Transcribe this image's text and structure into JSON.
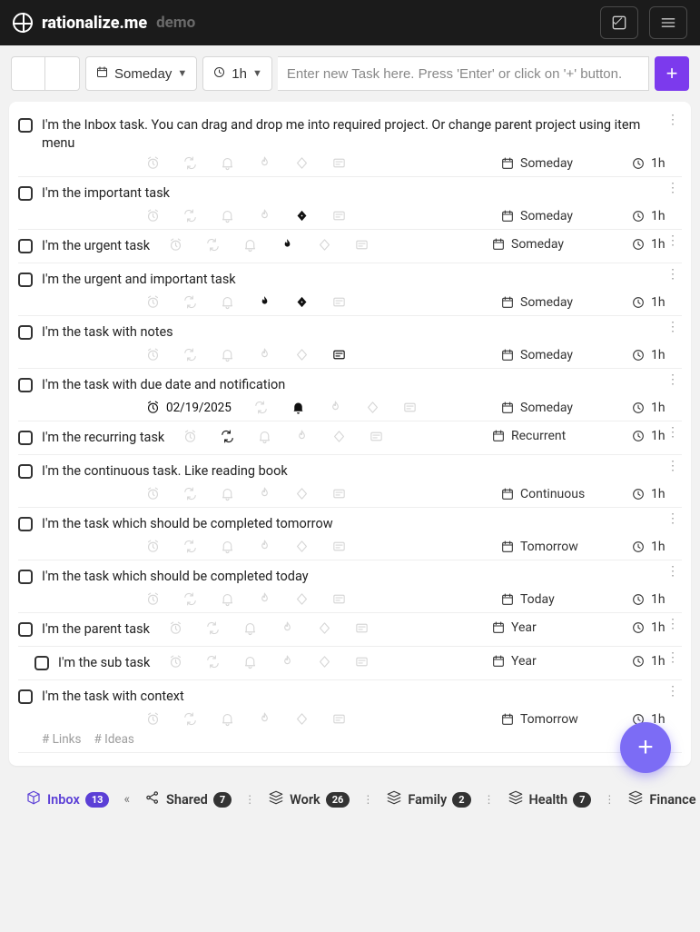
{
  "brand": {
    "name": "rationalize.me",
    "suffix": "demo"
  },
  "toolbar": {
    "schedule_label": "Someday",
    "duration_label": "1h",
    "input_placeholder": "Enter new Task here. Press 'Enter' or click on '+' button."
  },
  "tasks": [
    {
      "title": "I'm the Inbox task. You can drag and drop me into required project. Or change parent project using item menu",
      "schedule": "Someday",
      "duration": "1h",
      "flags": {
        "urgent": false,
        "important": false,
        "notes": false,
        "bell": false,
        "repeat": false,
        "due": false
      },
      "inline_meta": false,
      "sub": false
    },
    {
      "title": "I'm the important task",
      "schedule": "Someday",
      "duration": "1h",
      "flags": {
        "urgent": false,
        "important": true,
        "notes": false,
        "bell": false,
        "repeat": false,
        "due": false
      },
      "inline_meta": false,
      "sub": false
    },
    {
      "title": "I'm the urgent task",
      "schedule": "Someday",
      "duration": "1h",
      "flags": {
        "urgent": true,
        "important": false,
        "notes": false,
        "bell": false,
        "repeat": false,
        "due": false
      },
      "inline_meta": true,
      "sub": false
    },
    {
      "title": "I'm the urgent and important task",
      "schedule": "Someday",
      "duration": "1h",
      "flags": {
        "urgent": true,
        "important": true,
        "notes": false,
        "bell": false,
        "repeat": false,
        "due": false
      },
      "inline_meta": false,
      "sub": false
    },
    {
      "title": "I'm the task with notes",
      "schedule": "Someday",
      "duration": "1h",
      "flags": {
        "urgent": false,
        "important": false,
        "notes": true,
        "bell": false,
        "repeat": false,
        "due": false
      },
      "inline_meta": false,
      "sub": false
    },
    {
      "title": "I'm the task with due date and notification",
      "schedule": "Someday",
      "duration": "1h",
      "flags": {
        "urgent": false,
        "important": false,
        "notes": false,
        "bell": true,
        "repeat": false,
        "due": true
      },
      "due_date": "02/19/2025",
      "inline_meta": false,
      "sub": false
    },
    {
      "title": "I'm the recurring task",
      "schedule": "Recurrent",
      "duration": "1h",
      "flags": {
        "urgent": false,
        "important": false,
        "notes": false,
        "bell": false,
        "repeat": true,
        "due": false
      },
      "inline_meta": true,
      "sub": false
    },
    {
      "title": "I'm the continuous task. Like reading book",
      "schedule": "Continuous",
      "duration": "1h",
      "flags": {
        "urgent": false,
        "important": false,
        "notes": false,
        "bell": false,
        "repeat": false,
        "due": false
      },
      "inline_meta": false,
      "sub": false
    },
    {
      "title": "I'm the task which should be completed tomorrow",
      "schedule": "Tomorrow",
      "duration": "1h",
      "flags": {
        "urgent": false,
        "important": false,
        "notes": false,
        "bell": false,
        "repeat": false,
        "due": false
      },
      "inline_meta": false,
      "sub": false
    },
    {
      "title": "I'm the task which should be completed today",
      "schedule": "Today",
      "duration": "1h",
      "flags": {
        "urgent": false,
        "important": false,
        "notes": false,
        "bell": false,
        "repeat": false,
        "due": false
      },
      "inline_meta": false,
      "sub": false
    },
    {
      "title": "I'm the parent task",
      "schedule": "Year",
      "duration": "1h",
      "flags": {
        "urgent": false,
        "important": false,
        "notes": false,
        "bell": false,
        "repeat": false,
        "due": false
      },
      "inline_meta": true,
      "sub": false
    },
    {
      "title": "I'm the sub task",
      "schedule": "Year",
      "duration": "1h",
      "flags": {
        "urgent": false,
        "important": false,
        "notes": false,
        "bell": false,
        "repeat": false,
        "due": false
      },
      "inline_meta": true,
      "sub": true
    },
    {
      "title": "I'm the task with context",
      "schedule": "Tomorrow",
      "duration": "1h",
      "flags": {
        "urgent": false,
        "important": false,
        "notes": false,
        "bell": false,
        "repeat": false,
        "due": false
      },
      "tags": [
        "# Links",
        "# Ideas"
      ],
      "inline_meta": false,
      "sub": false
    }
  ],
  "projects": [
    {
      "name": "Inbox",
      "count": "13",
      "kind": "inbox"
    },
    {
      "name": "Shared",
      "count": "7",
      "kind": "shared"
    },
    {
      "name": "Work",
      "count": "26",
      "kind": "normal"
    },
    {
      "name": "Family",
      "count": "2",
      "kind": "normal"
    },
    {
      "name": "Health",
      "count": "7",
      "kind": "normal"
    },
    {
      "name": "Finance",
      "count": "",
      "kind": "normal"
    }
  ]
}
